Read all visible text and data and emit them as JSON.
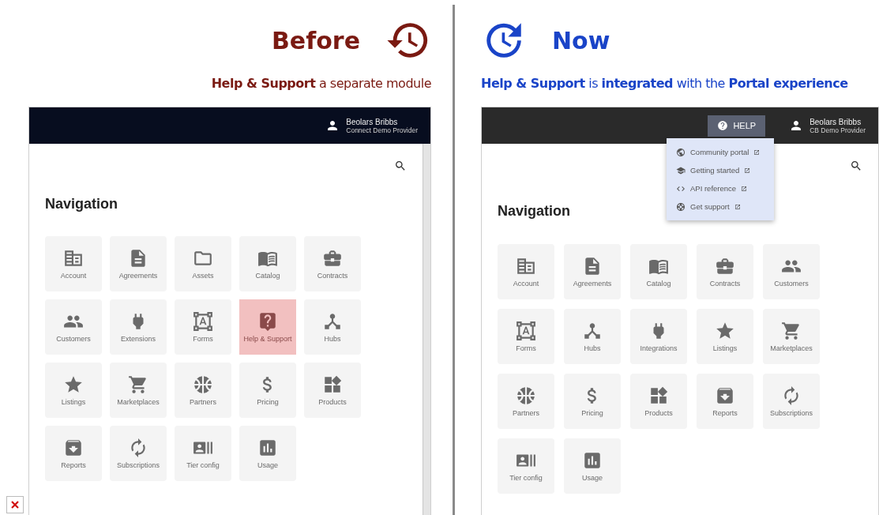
{
  "panels": [
    {
      "kind": "before",
      "heading": "Before",
      "subtitle": "**Help & Support** a separate module",
      "app": {
        "user": {
          "name": "Beolars Bribbs",
          "org": "Connect Demo Provider"
        },
        "section_title": "Navigation",
        "tiles": [
          {
            "kind": "account",
            "label": "Account",
            "highlighted": false
          },
          {
            "kind": "agreements",
            "label": "Agreements",
            "highlighted": false
          },
          {
            "kind": "assets",
            "label": "Assets",
            "highlighted": false
          },
          {
            "kind": "catalog",
            "label": "Catalog",
            "highlighted": false
          },
          {
            "kind": "contracts",
            "label": "Contracts",
            "highlighted": false
          },
          {
            "kind": "customers",
            "label": "Customers",
            "highlighted": false
          },
          {
            "kind": "plug",
            "label": "Extensions",
            "highlighted": false
          },
          {
            "kind": "forms",
            "label": "Forms",
            "highlighted": false
          },
          {
            "kind": "help",
            "label": "Help & Support",
            "highlighted": true
          },
          {
            "kind": "hubs",
            "label": "Hubs",
            "highlighted": false
          },
          {
            "kind": "listings",
            "label": "Listings",
            "highlighted": false
          },
          {
            "kind": "marketplaces",
            "label": "Marketplaces",
            "highlighted": false
          },
          {
            "kind": "partners",
            "label": "Partners",
            "highlighted": false
          },
          {
            "kind": "pricing",
            "label": "Pricing",
            "highlighted": false
          },
          {
            "kind": "products",
            "label": "Products",
            "highlighted": false
          },
          {
            "kind": "reports",
            "label": "Reports",
            "highlighted": false
          },
          {
            "kind": "subscriptions",
            "label": "Subscriptions",
            "highlighted": false
          },
          {
            "kind": "tiers",
            "label": "Tier config",
            "highlighted": false
          },
          {
            "kind": "usage",
            "label": "Usage",
            "highlighted": false
          }
        ]
      }
    },
    {
      "kind": "now",
      "heading": "Now",
      "subtitle": "**Help & Support** is **integrated** with the **Portal experience**",
      "app": {
        "help_button": {
          "label": "HELP",
          "expanded": true,
          "menu": [
            {
              "kind": "globe",
              "label": "Community portal"
            },
            {
              "kind": "school",
              "label": "Getting started"
            },
            {
              "kind": "code",
              "label": "API reference"
            },
            {
              "kind": "support",
              "label": "Get support"
            }
          ]
        },
        "user": {
          "name": "Beolars Bribbs",
          "org": "CB Demo Provider"
        },
        "section_title": "Navigation",
        "tiles": [
          {
            "kind": "account",
            "label": "Account",
            "highlighted": false
          },
          {
            "kind": "agreements",
            "label": "Agreements",
            "highlighted": false
          },
          {
            "kind": "catalog",
            "label": "Catalog",
            "highlighted": false
          },
          {
            "kind": "contracts",
            "label": "Contracts",
            "highlighted": false
          },
          {
            "kind": "customers",
            "label": "Customers",
            "highlighted": false
          },
          {
            "kind": "forms",
            "label": "Forms",
            "highlighted": false
          },
          {
            "kind": "hubs",
            "label": "Hubs",
            "highlighted": false
          },
          {
            "kind": "plug",
            "label": "Integrations",
            "highlighted": false
          },
          {
            "kind": "listings",
            "label": "Listings",
            "highlighted": false
          },
          {
            "kind": "marketplaces",
            "label": "Marketplaces",
            "highlighted": false
          },
          {
            "kind": "partners",
            "label": "Partners",
            "highlighted": false
          },
          {
            "kind": "pricing",
            "label": "Pricing",
            "highlighted": false
          },
          {
            "kind": "products",
            "label": "Products",
            "highlighted": false
          },
          {
            "kind": "reports",
            "label": "Reports",
            "highlighted": false
          },
          {
            "kind": "subscriptions",
            "label": "Subscriptions",
            "highlighted": false
          },
          {
            "kind": "tiers",
            "label": "Tier config",
            "highlighted": false
          },
          {
            "kind": "usage",
            "label": "Usage",
            "highlighted": false
          }
        ]
      }
    }
  ]
}
